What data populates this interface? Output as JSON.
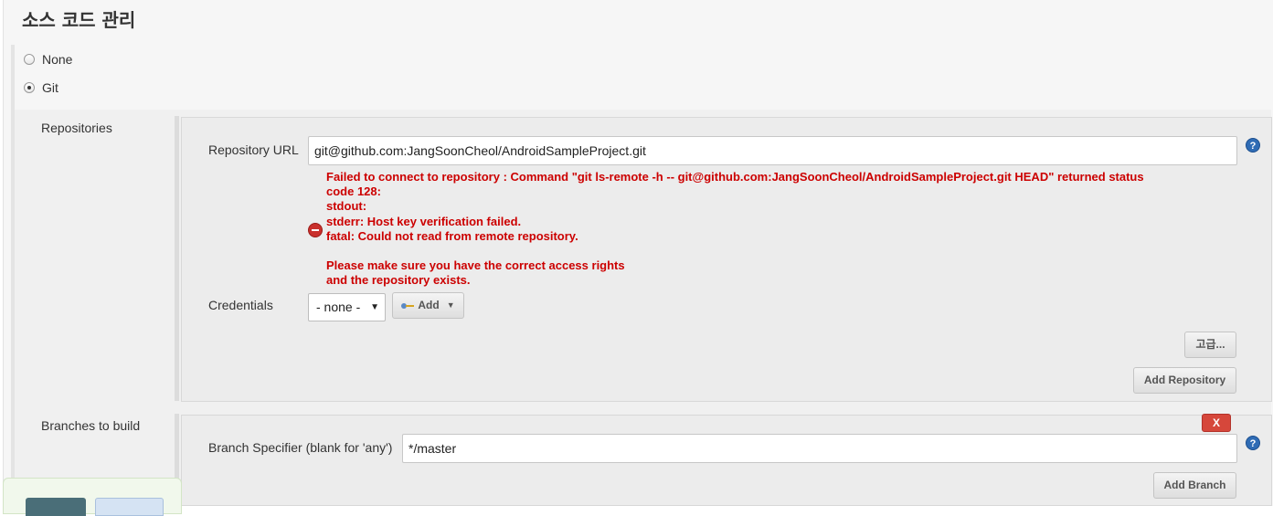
{
  "section": {
    "title": "소스 코드 관리"
  },
  "scm_options": [
    {
      "label": "None",
      "selected": false
    },
    {
      "label": "Git",
      "selected": true
    }
  ],
  "repositories": {
    "label": "Repositories",
    "url_label": "Repository URL",
    "url_value": "git@github.com:JangSoonCheol/AndroidSampleProject.git",
    "error_lines": "Failed to connect to repository : Command \"git ls-remote -h -- git@github.com:JangSoonCheol/AndroidSampleProject.git HEAD\" returned status\ncode 128:\nstdout:\nstderr: Host key verification failed.\nfatal: Could not read from remote repository.\n\nPlease make sure you have the correct access rights\nand the repository exists.",
    "credentials_label": "Credentials",
    "credentials_value": "- none -",
    "add_button": "Add",
    "advanced_button": "고급...",
    "add_repository_button": "Add Repository",
    "help_icon": "?"
  },
  "branches": {
    "label": "Branches to build",
    "specifier_label": "Branch Specifier (blank for 'any')",
    "specifier_value": "*/master",
    "delete_button": "X",
    "add_branch_button": "Add Branch",
    "help_icon": "?"
  },
  "colors": {
    "error": "#cc0000",
    "help": "#2f6cb5",
    "delete": "#d6473b"
  }
}
